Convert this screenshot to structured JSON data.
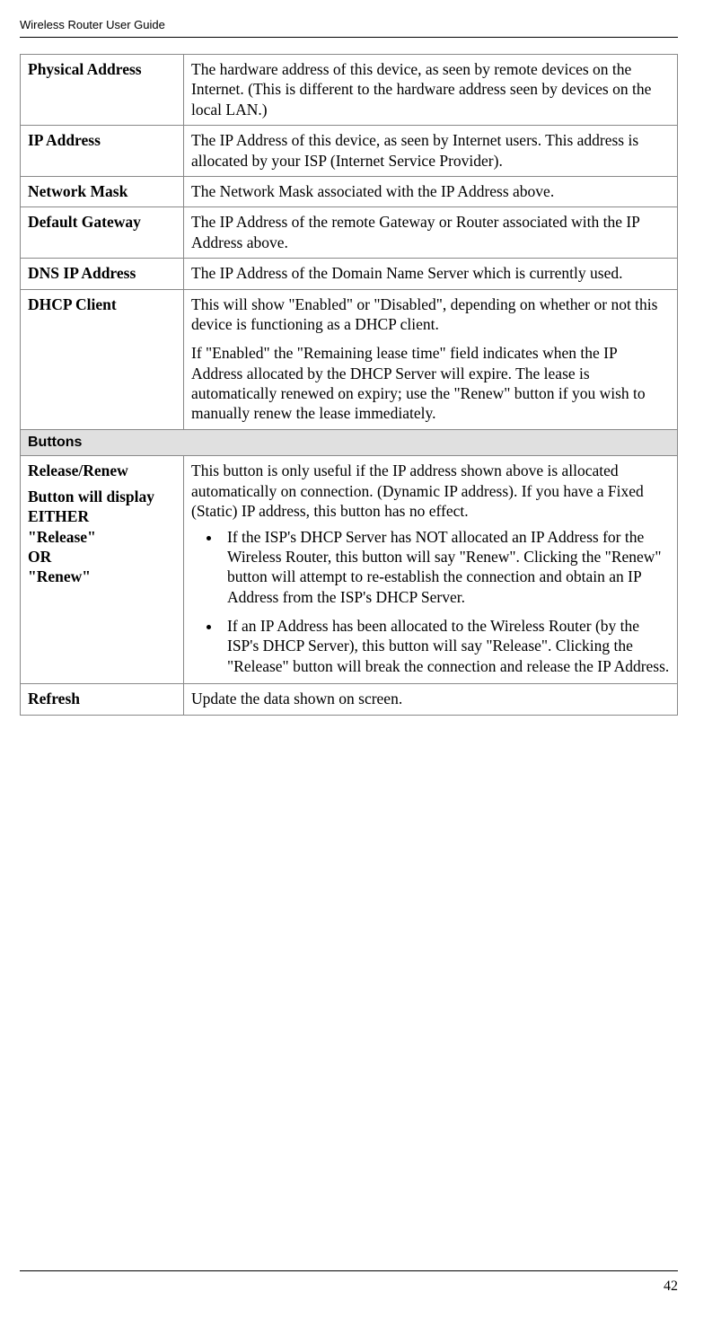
{
  "header_title": "Wireless Router User Guide",
  "page_number": "42",
  "rows": {
    "physical_address": {
      "label": "Physical Address",
      "desc": "The hardware address of this device, as seen by remote devices on the Internet. (This is different to the hardware address seen by devices on the local LAN.)"
    },
    "ip_address": {
      "label": "IP Address",
      "desc": "The IP Address of this device, as seen by Internet users. This address is allocated by your ISP (Internet Service Provider)."
    },
    "network_mask": {
      "label": "Network Mask",
      "desc": "The Network Mask associated with the IP Address above."
    },
    "default_gateway": {
      "label": "Default Gateway",
      "desc": "The IP Address of the remote Gateway or Router associated with the IP Address above."
    },
    "dns_ip_address": {
      "label": "DNS IP Address",
      "desc": "The IP Address of the Domain Name Server which is currently used."
    },
    "dhcp_client": {
      "label": "DHCP Client",
      "desc1": "This will show \"Enabled\" or \"Disabled\", depending on whether or not this device is functioning as a DHCP client.",
      "desc2": "If \"Enabled\" the \"Remaining lease time\" field indicates when the IP Address allocated by the DHCP Server will expire. The lease is automatically renewed on expiry; use the \"Renew\" button if you wish to manually renew the lease immediately."
    },
    "buttons_section": "Buttons",
    "release_renew": {
      "label_main": "Release/Renew",
      "label_sub1": "Button will display EITHER",
      "label_sub2": "\"Release\"",
      "label_sub3": "OR",
      "label_sub4": "\"Renew\"",
      "desc_intro": "This button is only useful if the IP address shown above is allocated automatically on connection. (Dynamic IP address). If you have a Fixed (Static) IP address, this button has no effect.",
      "bullet1": "If the ISP's DHCP Server has NOT allocated an IP Address for the Wireless Router, this button will say \"Renew\". Clicking the \"Renew\" button will attempt to re-establish the connection and obtain an IP Address from the ISP's DHCP Server.",
      "bullet2": "If an IP Address has been allocated to the Wireless Router (by the ISP's DHCP Server), this button will say \"Release\". Clicking the \"Release\" button will break the connection and release the IP Address."
    },
    "refresh": {
      "label": "Refresh",
      "desc": "Update the data shown on screen."
    }
  }
}
